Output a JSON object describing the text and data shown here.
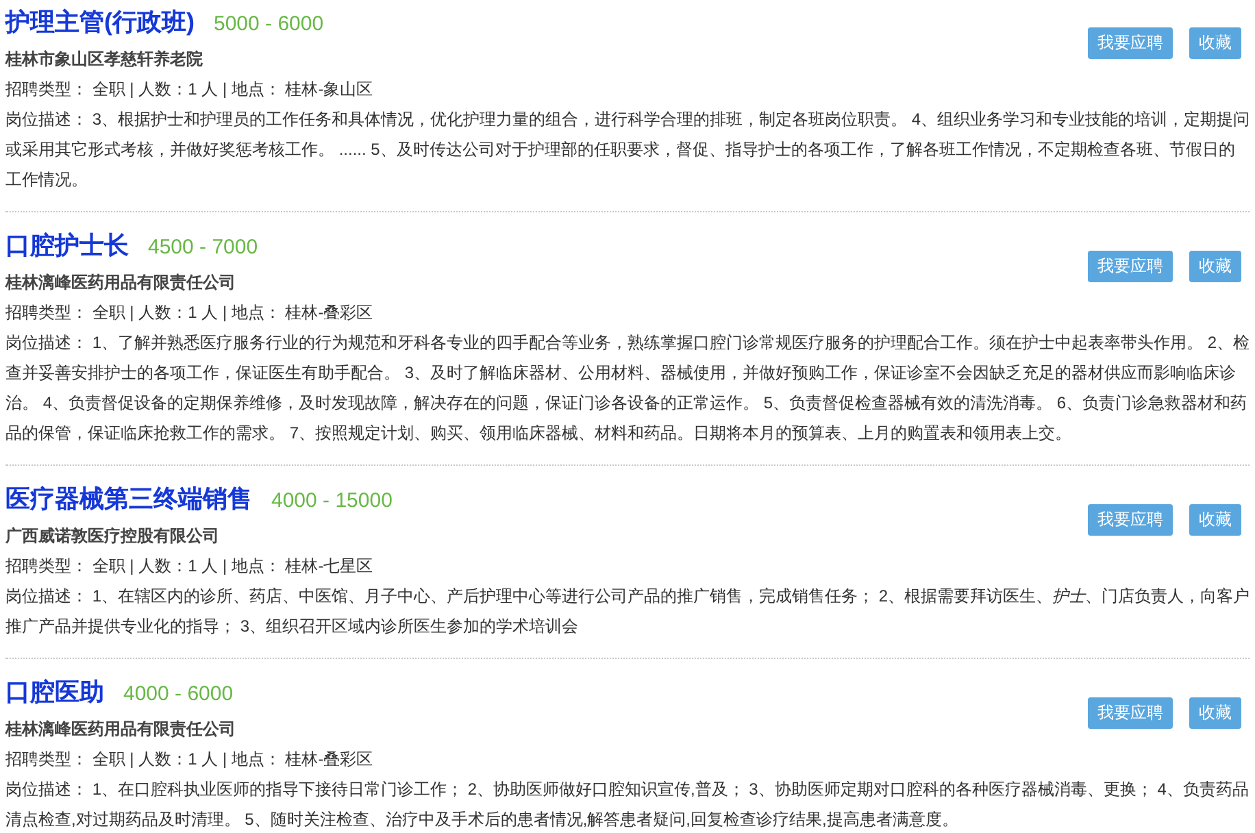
{
  "jobs": [
    {
      "title": "护理主管(行政班)",
      "salary": "5000 - 6000",
      "company": "桂林市象山区孝慈轩养老院",
      "meta": "招聘类型： 全职 | 人数：1 人 | 地点： 桂林-象山区",
      "description": "岗位描述： 3、根据护士和护理员的工作任务和具体情况，优化护理力量的组合，进行科学合理的排班，制定各班岗位职责。 4、组织业务学习和专业技能的培训，定期提问或采用其它形式考核，并做好奖惩考核工作。 ...... 5、及时传达公司对于护理部的任职要求，督促、指导护士的各项工作，了解各班工作情况，不定期检查各班、节假日的工作情况。",
      "apply": "我要应聘",
      "favorite": "收藏"
    },
    {
      "title": "口腔护士长",
      "salary": "4500 - 7000",
      "company": "桂林漓峰医药用品有限责任公司",
      "meta": "招聘类型： 全职 | 人数：1 人 | 地点： 桂林-叠彩区",
      "description": "岗位描述： 1、了解并熟悉医疗服务行业的行为规范和牙科各专业的四手配合等业务，熟练掌握口腔门诊常规医疗服务的护理配合工作。须在护士中起表率带头作用。 2、检查并妥善安排护士的各项工作，保证医生有助手配合。 3、及时了解临床器材、公用材料、器械使用，并做好预购工作，保证诊室不会因缺乏充足的器材供应而影响临床诊治。 4、负责督促设备的定期保养维修，及时发现故障，解决存在的问题，保证门诊各设备的正常运作。 5、负责督促检查器械有效的清洗消毒。 6、负责门诊急救器材和药品的保管，保证临床抢救工作的需求。 7、按照规定计划、购买、领用临床器械、材料和药品。日期将本月的预算表、上月的购置表和领用表上交。",
      "apply": "我要应聘",
      "favorite": "收藏"
    },
    {
      "title": "医疗器械第三终端销售",
      "salary": "4000 - 15000",
      "company": "广西威诺敦医疗控股有限公司",
      "meta": "招聘类型： 全职 | 人数：1 人 | 地点： 桂林-七星区",
      "description": "岗位描述： 1、在辖区内的诊所、药店、中医馆、月子中心、产后护理中心等进行公司产品的推广销售，完成销售任务； 2、根据需要拜访医生、*护士*、门店负责人，向客户推广产品并提供专业化的指导； 3、组织召开区域内诊所医生参加的学术培训会",
      "apply": "我要应聘",
      "favorite": "收藏"
    },
    {
      "title": "口腔医助",
      "salary": "4000 - 6000",
      "company": "桂林漓峰医药用品有限责任公司",
      "meta": "招聘类型： 全职 | 人数：1 人 | 地点： 桂林-叠彩区",
      "description": "岗位描述： 1、在口腔科执业医师的指导下接待日常门诊工作； 2、协助医师做好口腔知识宣传,普及； 3、协助医师定期对口腔科的各种医疗器械消毒、更换； 4、负责药品清点检查,对过期药品及时清理。 5、随时关注检查、治疗中及手术后的患者情况,解答患者疑问,回复检查诊疗结果,提高患者满意度。",
      "apply": "我要应聘",
      "favorite": "收藏"
    }
  ]
}
